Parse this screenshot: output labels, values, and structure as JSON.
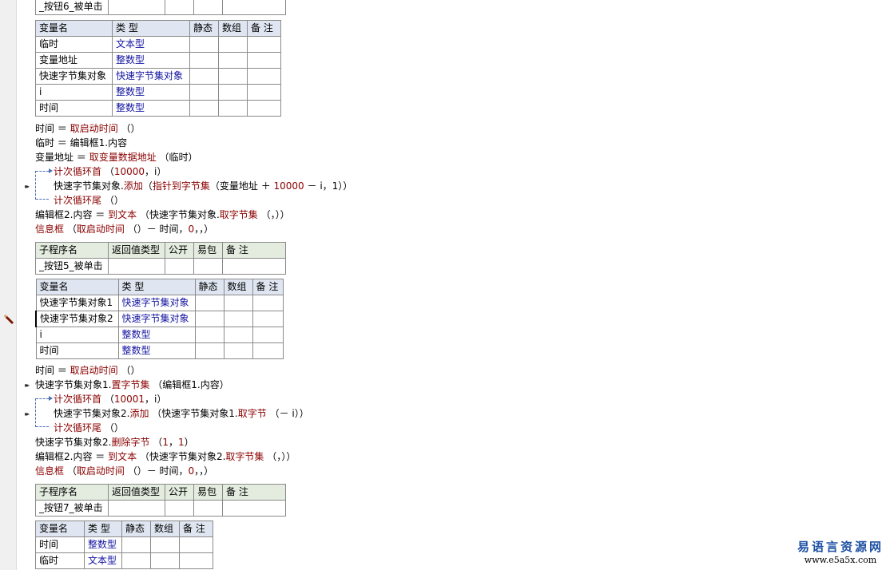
{
  "table_headers": {
    "sub_cols": [
      "子程序名",
      "返回值类型",
      "公开",
      "易包",
      "备 注"
    ],
    "var_cols": [
      "变量名",
      "类 型",
      "静态",
      "数组",
      "备 注"
    ]
  },
  "top_partial_row": {
    "name": "_按钮6_被单击"
  },
  "block1": {
    "vars": [
      {
        "name": "临时",
        "type": "文本型"
      },
      {
        "name": "变量地址",
        "type": "整数型"
      },
      {
        "name": "快速字节集对象",
        "type": "快速字节集对象"
      },
      {
        "name": "i",
        "type": "整数型"
      },
      {
        "name": "时间",
        "type": "整数型"
      }
    ],
    "code": {
      "l1_var": "时间",
      "l1_op": "＝",
      "l1_fn": "取启动时间",
      "l1_args": "（）",
      "l2": "临时 ＝ 编辑框1.内容",
      "l3_var": "变量地址",
      "l3_op": "＝",
      "l3_fn": "取变量数据地址",
      "l3_args": "（临时）",
      "l4_fn": "计次循环首",
      "l4_args": "（",
      "l4_num": "10000",
      "l4_rest": "，i）",
      "l5_obj": "快速字节集对象.",
      "l5_fn": "添加",
      "l5_a": "（",
      "l5_fn2": "指针到字节集",
      "l5_b": "（变量地址 ＋ ",
      "l5_num": "10000",
      "l5_c": " － i，1））",
      "l6_fn": "计次循环尾",
      "l6_args": "（）",
      "l7_a": "编辑框2.内容 ＝ ",
      "l7_fn": "到文本",
      "l7_b": "（快速字节集对象.",
      "l7_fn2": "取字节集",
      "l7_c": "（，））",
      "l8_fn": "信息框",
      "l8_a": "（",
      "l8_fn2": "取启动时间",
      "l8_b": "（）－ 时间，",
      "l8_num": "0",
      "l8_c": "，，）"
    }
  },
  "block2": {
    "sub": {
      "name": "_按钮5_被单击"
    },
    "vars": [
      {
        "name": "快速字节集对象1",
        "type": "快速字节集对象"
      },
      {
        "name": "快速字节集对象2",
        "type": "快速字节集对象"
      },
      {
        "name": "i",
        "type": "整数型"
      },
      {
        "name": "时间",
        "type": "整数型"
      }
    ],
    "code": {
      "l1_var": "时间 ＝ ",
      "l1_fn": "取启动时间",
      "l1_args": "（）",
      "l2_obj": "快速字节集对象1.",
      "l2_fn": "置字节集",
      "l2_args": "（编辑框1.内容）",
      "l3_fn": "计次循环首",
      "l3_a": "（",
      "l3_num": "10001",
      "l3_b": "，i）",
      "l4_obj": "快速字节集对象2.",
      "l4_fn": "添加",
      "l4_a": "（快速字节集对象1.",
      "l4_fn2": "取字节",
      "l4_b": "（－ i））",
      "l5_fn": "计次循环尾",
      "l5_args": "（）",
      "l6_obj": "快速字节集对象2.",
      "l6_fn": "删除字节",
      "l6_a": "（",
      "l6_num1": "1",
      "l6_b": "，",
      "l6_num2": "1",
      "l6_c": "）",
      "l7_a": "编辑框2.内容 ＝ ",
      "l7_fn": "到文本",
      "l7_b": "（快速字节集对象2.",
      "l7_fn2": "取字节集",
      "l7_c": "（，））",
      "l8_fn": "信息框",
      "l8_a": "（",
      "l8_fn2": "取启动时间",
      "l8_b": "（）－ 时间，",
      "l8_num": "0",
      "l8_c": "，，）"
    }
  },
  "block3": {
    "sub": {
      "name": "_按钮7_被单击"
    },
    "vars": [
      {
        "name": "时间",
        "type": "整数型"
      },
      {
        "name": "临时",
        "type": "文本型"
      }
    ]
  },
  "watermark": {
    "cn": "易语言资源网",
    "url": "www.e5a5x.com"
  },
  "colors": {
    "type_text": "#1313a0",
    "function_text": "#8b0000",
    "header_bg": "#dfe6f1",
    "sub_header_bg": "#e3ecdf",
    "logo": "#1c4fa3"
  }
}
